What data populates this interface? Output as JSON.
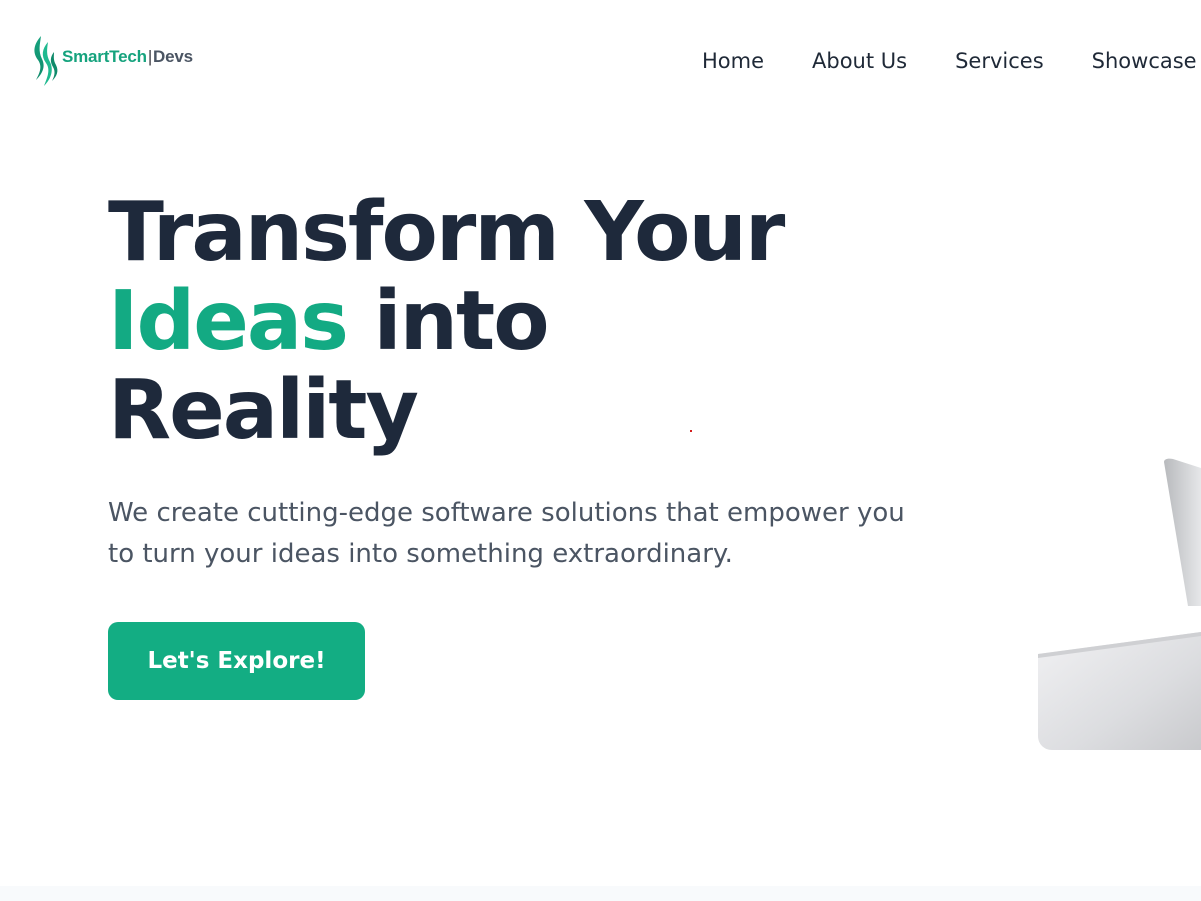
{
  "header": {
    "logo": {
      "brand": "SmartTech",
      "separator": "|",
      "suffix": "Devs",
      "icon": "smarttech-flame-logo-icon"
    },
    "nav": {
      "items": [
        {
          "label": "Home"
        },
        {
          "label": "About Us"
        },
        {
          "label": "Services"
        },
        {
          "label": "Showcase"
        }
      ]
    }
  },
  "hero": {
    "title": {
      "line1": "Transform Your",
      "accent": "Ideas",
      "line2_rest": " into",
      "line3": "Reality"
    },
    "subtitle": "We create cutting-edge software solutions that empower you to turn your ideas into something extraordinary.",
    "cta_label": "Let's Explore!",
    "image": "laptop-photo-image"
  },
  "colors": {
    "accent": "#13ad83",
    "heading": "#1e293b",
    "body": "#4b5563",
    "background": "#ffffff"
  }
}
